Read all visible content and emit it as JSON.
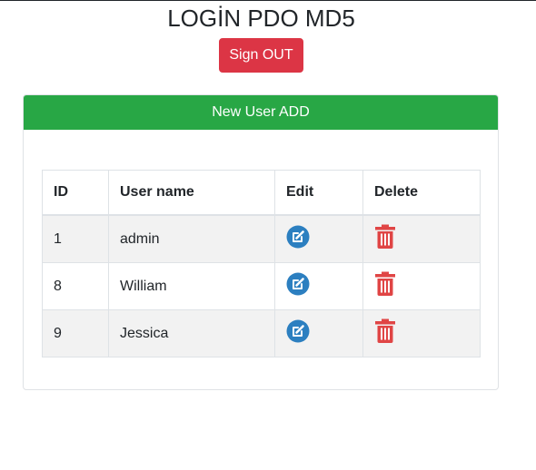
{
  "header": {
    "title": "LOGİN PDO MD5",
    "signout_label": "Sign OUT"
  },
  "card": {
    "add_label": "New User ADD"
  },
  "table": {
    "columns": [
      "ID",
      "User name",
      "Edit",
      "Delete"
    ],
    "rows": [
      {
        "id": "1",
        "name": "admin"
      },
      {
        "id": "8",
        "name": "William"
      },
      {
        "id": "9",
        "name": "Jessica"
      }
    ],
    "edit_icon": "edit-icon",
    "delete_icon": "trash-icon"
  },
  "colors": {
    "danger": "#dc3545",
    "success": "#28a745",
    "edit_blue": "#2c7fc0",
    "stripe": "#f2f2f2"
  }
}
